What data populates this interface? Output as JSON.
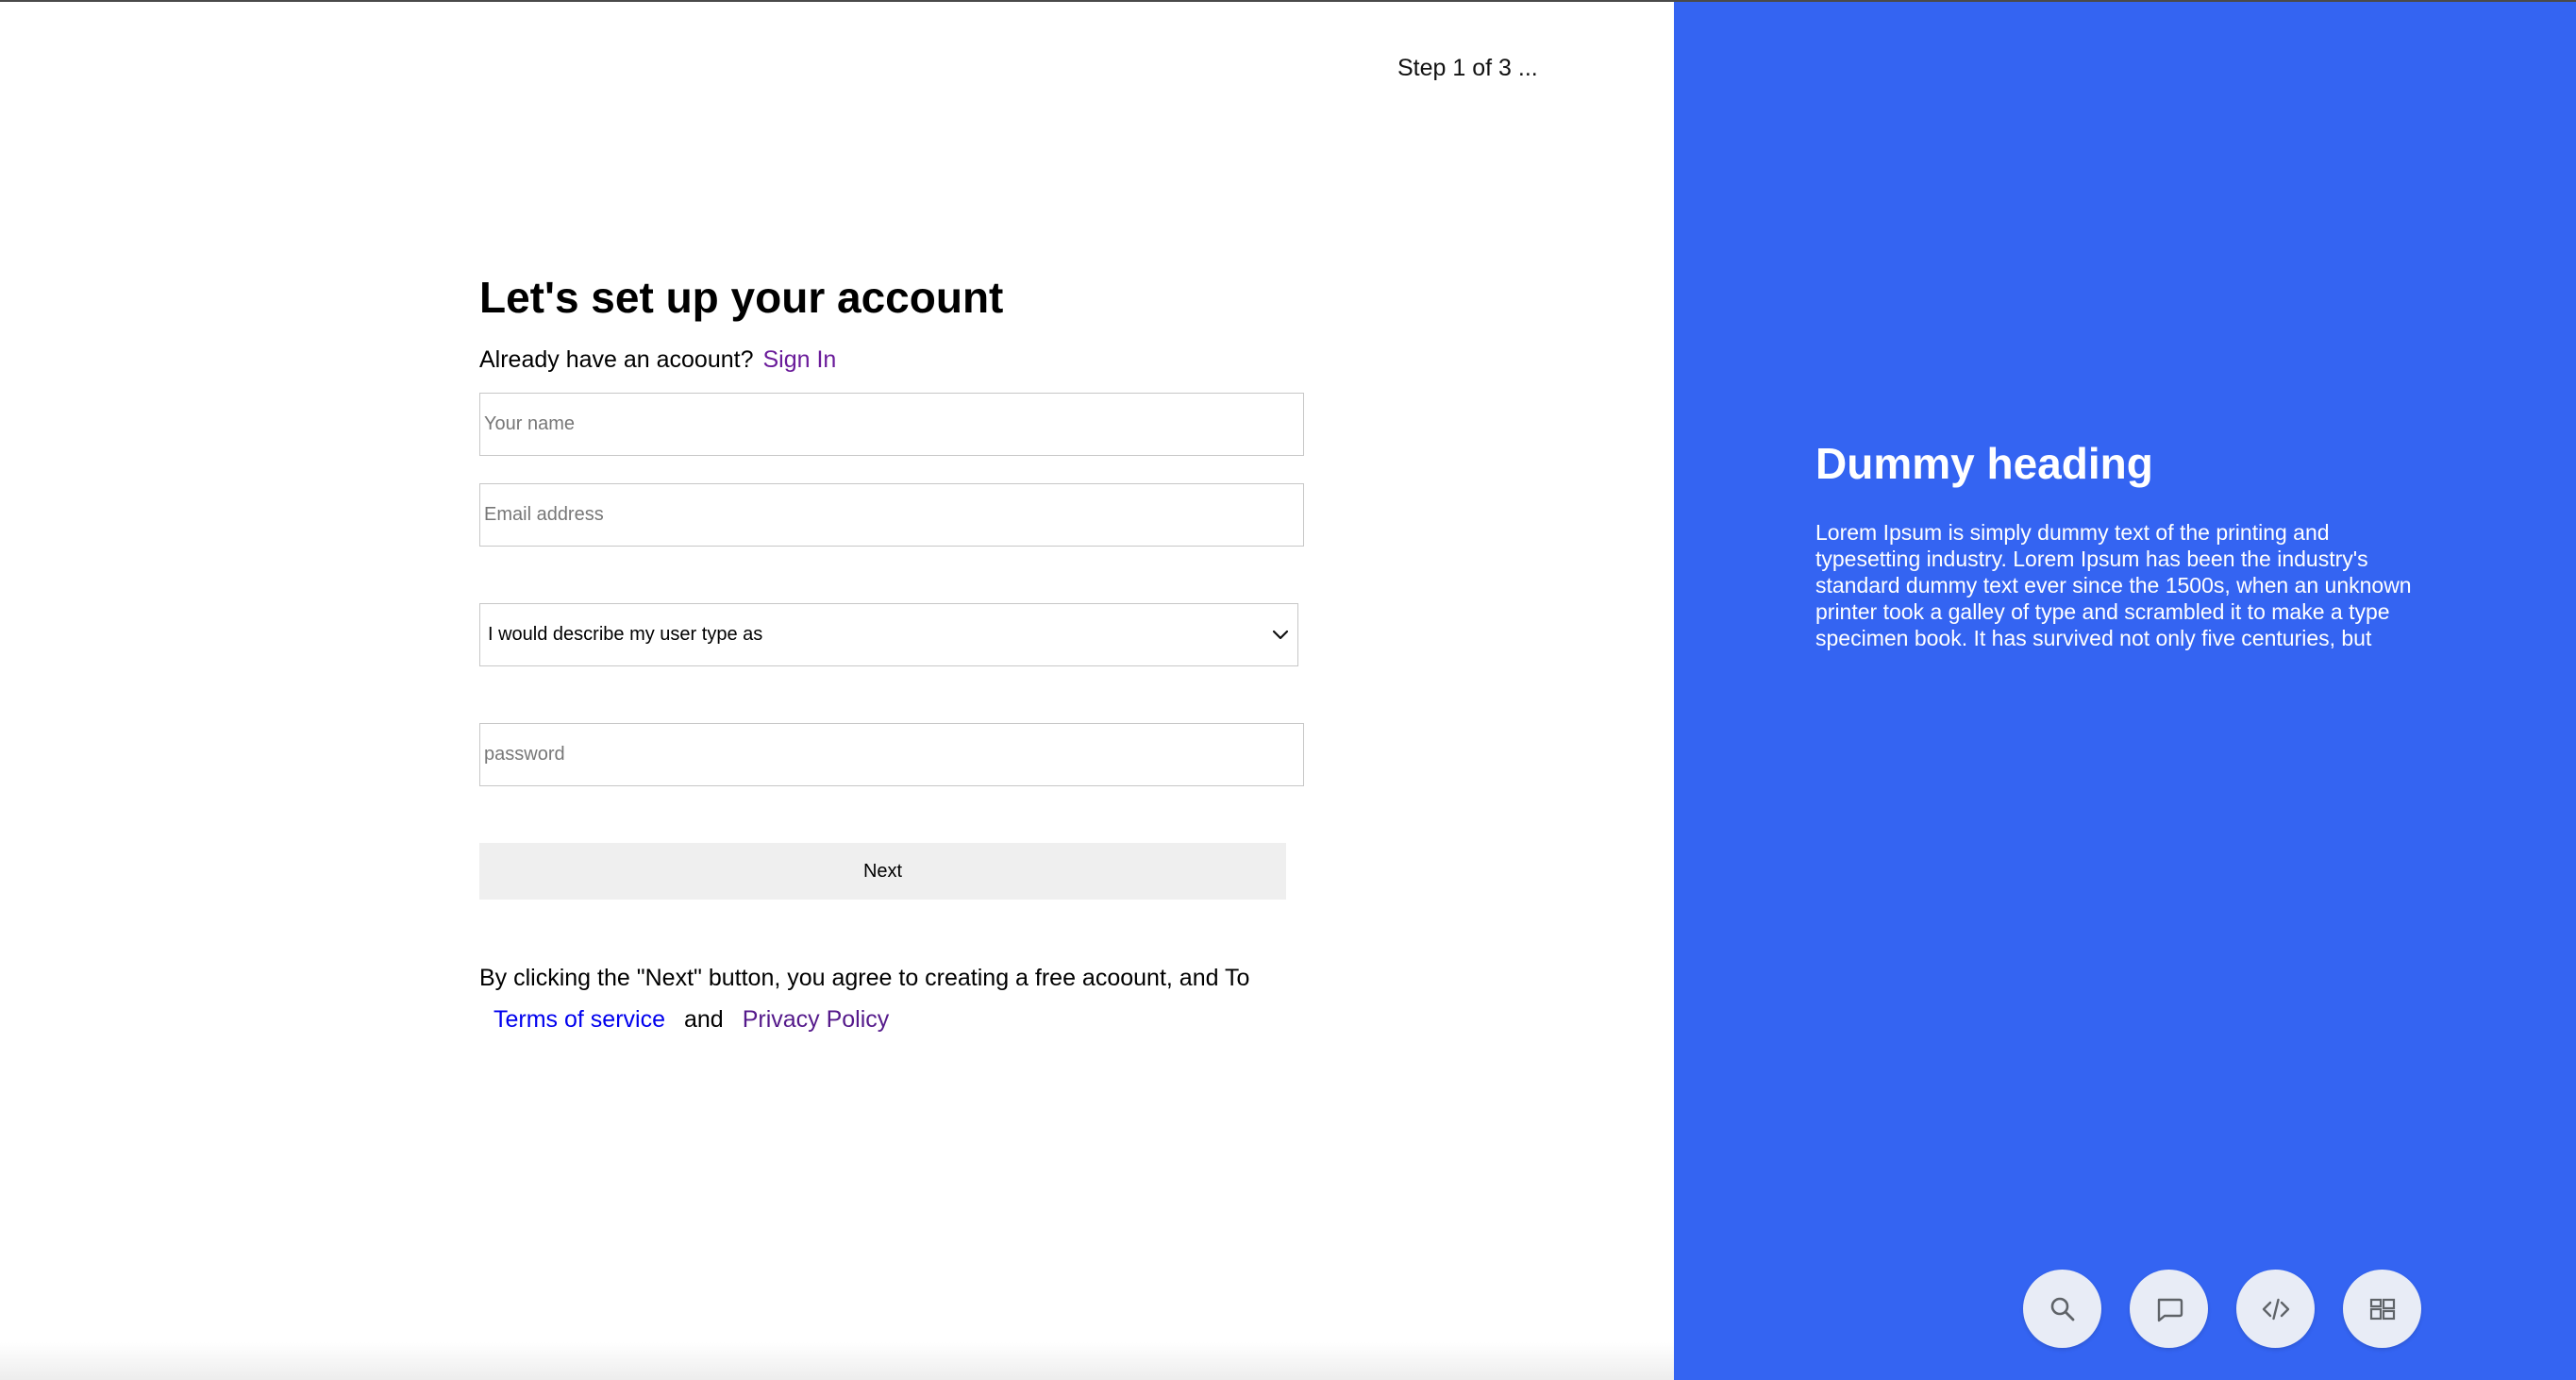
{
  "left": {
    "step_indicator": "Step 1 of 3 ...",
    "title": "Let's set up your account",
    "signin_prompt": "Already have an acoount?",
    "signin_link": "Sign In",
    "fields": {
      "name_placeholder": "Your name",
      "email_placeholder": "Email address",
      "user_type_selected": "I would describe my user type as",
      "password_placeholder": "password"
    },
    "next_button": "Next",
    "terms_text": "By clicking the \"Next\" button, you agree to creating a free acoount, and To",
    "terms_link": "Terms of service",
    "and_text": "and",
    "privacy_link": "Privacy Policy"
  },
  "right": {
    "heading": "Dummy heading",
    "body": "Lorem Ipsum is simply dummy text of the printing and typesetting industry. Lorem Ipsum has been the industry's standard dummy text ever since the 1500s, when an unknown printer took a galley of type and scrambled it to make a type specimen book. It has survived not only five centuries, but",
    "fab_icons": [
      "search-icon",
      "chat-icon",
      "code-icon",
      "layout-icon"
    ]
  },
  "colors": {
    "accent_panel": "#3464f2",
    "signin_link": "#6a1b9a",
    "terms_link": "#0000ee",
    "privacy_link": "#551a8b",
    "button_bg": "#efefef"
  }
}
